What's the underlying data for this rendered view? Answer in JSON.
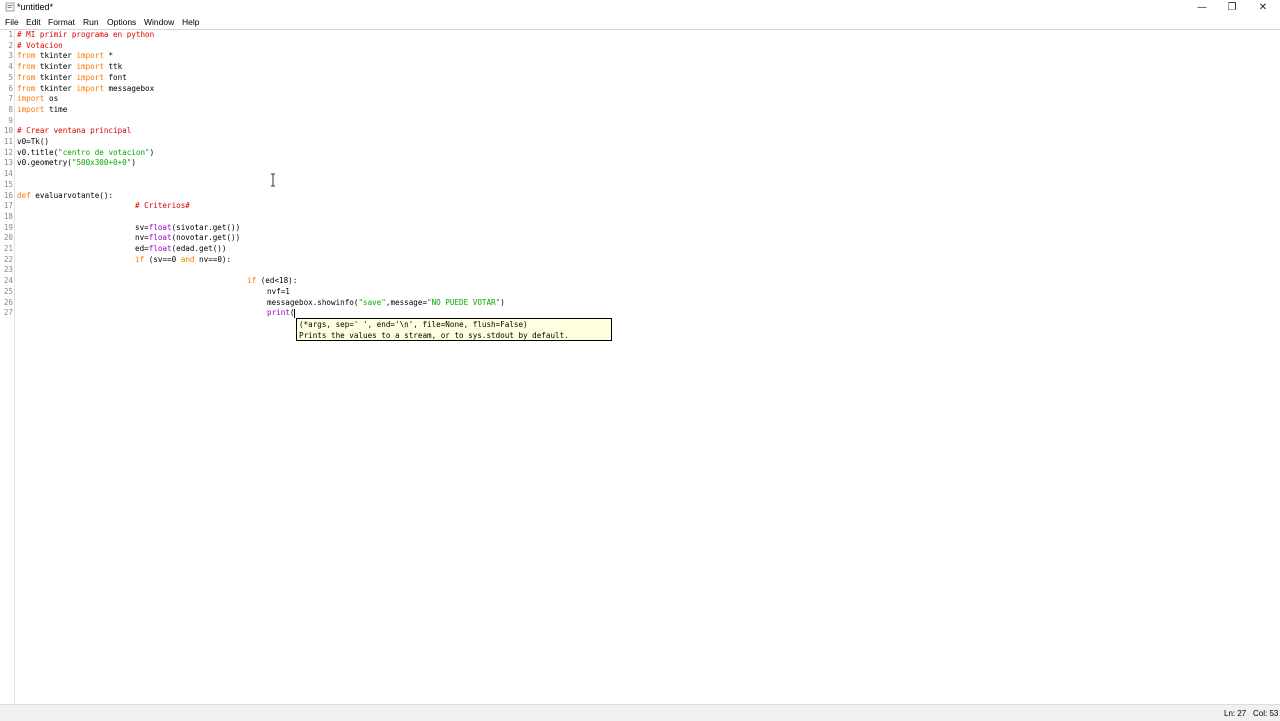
{
  "window": {
    "title": "*untitled*",
    "minimize": "—",
    "restore": "❐",
    "close": "✕"
  },
  "menu": [
    "File",
    "Edit",
    "Format",
    "Run",
    "Options",
    "Window",
    "Help"
  ],
  "line_numbers": [
    "1",
    "2",
    "3",
    "4",
    "5",
    "6",
    "7",
    "8",
    "9",
    "10",
    "11",
    "12",
    "13",
    "14",
    "15",
    "16",
    "17",
    "18",
    "19",
    "20",
    "21",
    "22",
    "23",
    "24",
    "25",
    "26",
    "27"
  ],
  "code": {
    "l1": "# MI primir programa en python",
    "l2": "# Votacion",
    "from": "from",
    "import": "import",
    "l3_mod": "tkinter",
    "l3_what": "*",
    "l4_what": "ttk",
    "l5_what": "font",
    "l6_what": "messagebox",
    "l7_mod": "os",
    "l8_mod": "time",
    "l10": "# Crear ventana principal",
    "l11": "v0=Tk()",
    "l12_a": "v0.title(",
    "l12_s": "\"centro de votacion\"",
    "l12_b": ")",
    "l13_a": "v0.geometry(",
    "l13_s": "\"500x300+0+0\"",
    "l13_b": ")",
    "def": "def",
    "l16_rest": "evaluarvotante():",
    "l17": "# Criterios#",
    "l19_a": "sv=",
    "float": "float",
    "l19_b": "(sivotar.get())",
    "l20_a": "nv=",
    "l20_b": "(novotar.get())",
    "l21_a": "ed=",
    "l21_b": "(edad.get())",
    "if": "if",
    "l22_a": "(sv==0",
    "and": "and",
    "l22_b": "nv==0):",
    "l24_b": "(ed<18):",
    "l25": "nvf=1",
    "l26_a": "messagebox.showinfo(",
    "l26_s1": "\"save\"",
    "l26_b": ",message=",
    "l26_s2": "\"NO PUEDE VOTAR\"",
    "l26_c": ")",
    "print": "print",
    "l27_b": "("
  },
  "tooltip": {
    "line1": "(*args, sep=' ', end='\\n', file=None, flush=False)",
    "line2": "Prints the values to a stream, or to sys.stdout by default."
  },
  "status": {
    "ln": "Ln: 27",
    "col": "Col: 53"
  },
  "colors": {
    "keyword": "#ff7700",
    "builtin": "#9b00c9",
    "comment": "#dd0000",
    "string": "#00aa00",
    "tooltip_bg": "#ffffe0"
  }
}
